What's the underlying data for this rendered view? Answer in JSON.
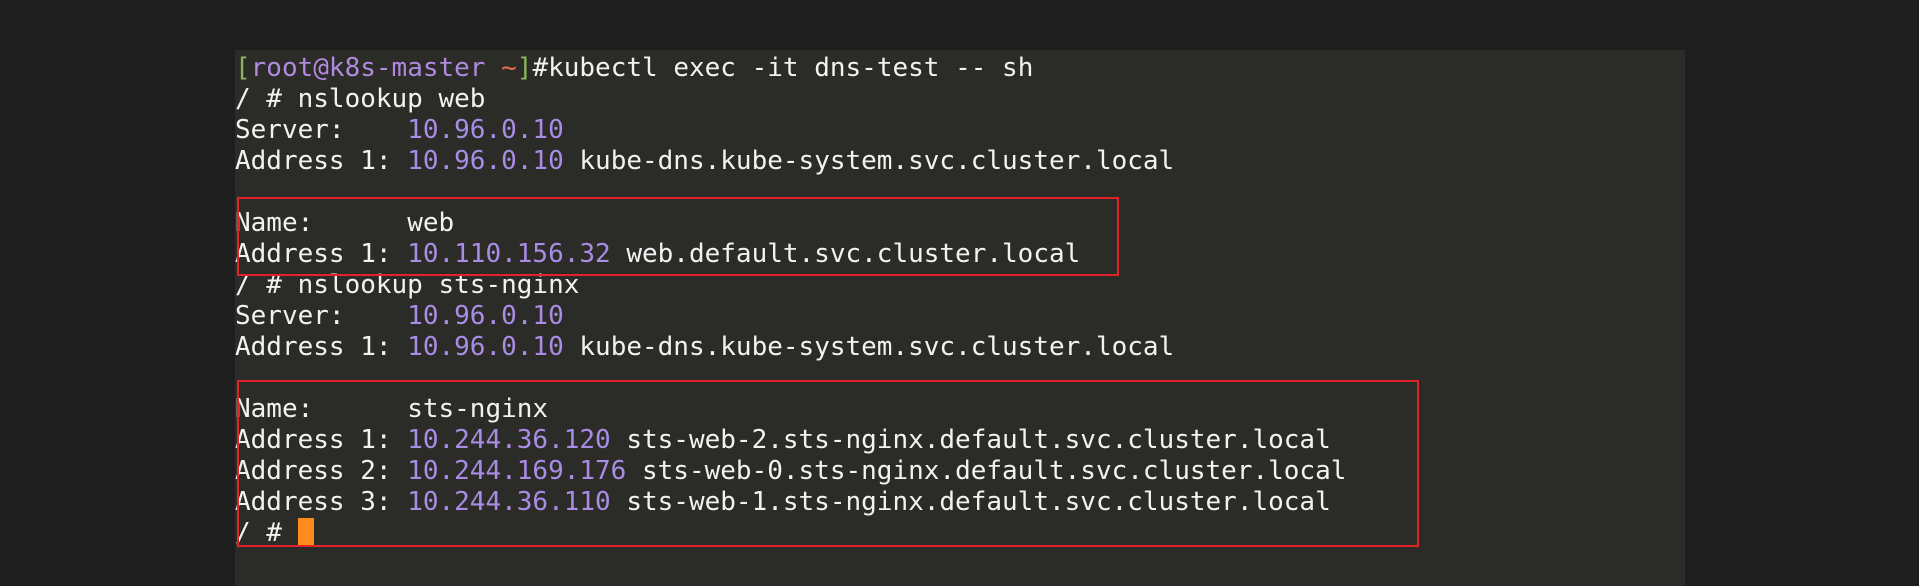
{
  "prompt": {
    "open_bracket": "[",
    "user_host": "root@k8s-master",
    "space": " ",
    "tilde": "~",
    "close_bracket": "]",
    "hash": "#",
    "command": "kubectl exec -it dns-test -- sh"
  },
  "lines": [
    {
      "text": "/ # nslookup web"
    },
    {
      "label": "Server:    ",
      "ip": "10.96.0.10",
      "rest": ""
    },
    {
      "label": "Address 1: ",
      "ip": "10.96.0.10",
      "rest": " kube-dns.kube-system.svc.cluster.local"
    },
    {
      "label": "Name:      ",
      "value": "web"
    },
    {
      "label": "Address 1: ",
      "ip": "10.110.156.32",
      "rest": " web.default.svc.cluster.local"
    },
    {
      "text": "/ # nslookup sts-nginx"
    },
    {
      "label": "Server:    ",
      "ip": "10.96.0.10",
      "rest": ""
    },
    {
      "label": "Address 1: ",
      "ip": "10.96.0.10",
      "rest": " kube-dns.kube-system.svc.cluster.local"
    },
    {
      "label": "Name:      ",
      "value": "sts-nginx"
    },
    {
      "label": "Address 1: ",
      "ip": "10.244.36.120",
      "rest": " sts-web-2.sts-nginx.default.svc.cluster.local"
    },
    {
      "label": "Address 2: ",
      "ip": "10.244.169.176",
      "rest": " sts-web-0.sts-nginx.default.svc.cluster.local"
    },
    {
      "label": "Address 3: ",
      "ip": "10.244.36.110",
      "rest": " sts-web-1.sts-nginx.default.svc.cluster.local"
    },
    {
      "text": "/ # "
    }
  ],
  "colors": {
    "page_bg": "#1e1e1e",
    "terminal_bg": "#2b2b27",
    "text": "#f2f2f2",
    "ip": "#a98ce6",
    "prompt_bracket": "#8ab85a",
    "prompt_user": "#b08adf",
    "prompt_tilde": "#e56e4c",
    "cursor": "#ff8a1e",
    "highlight_border": "#e2232a"
  }
}
